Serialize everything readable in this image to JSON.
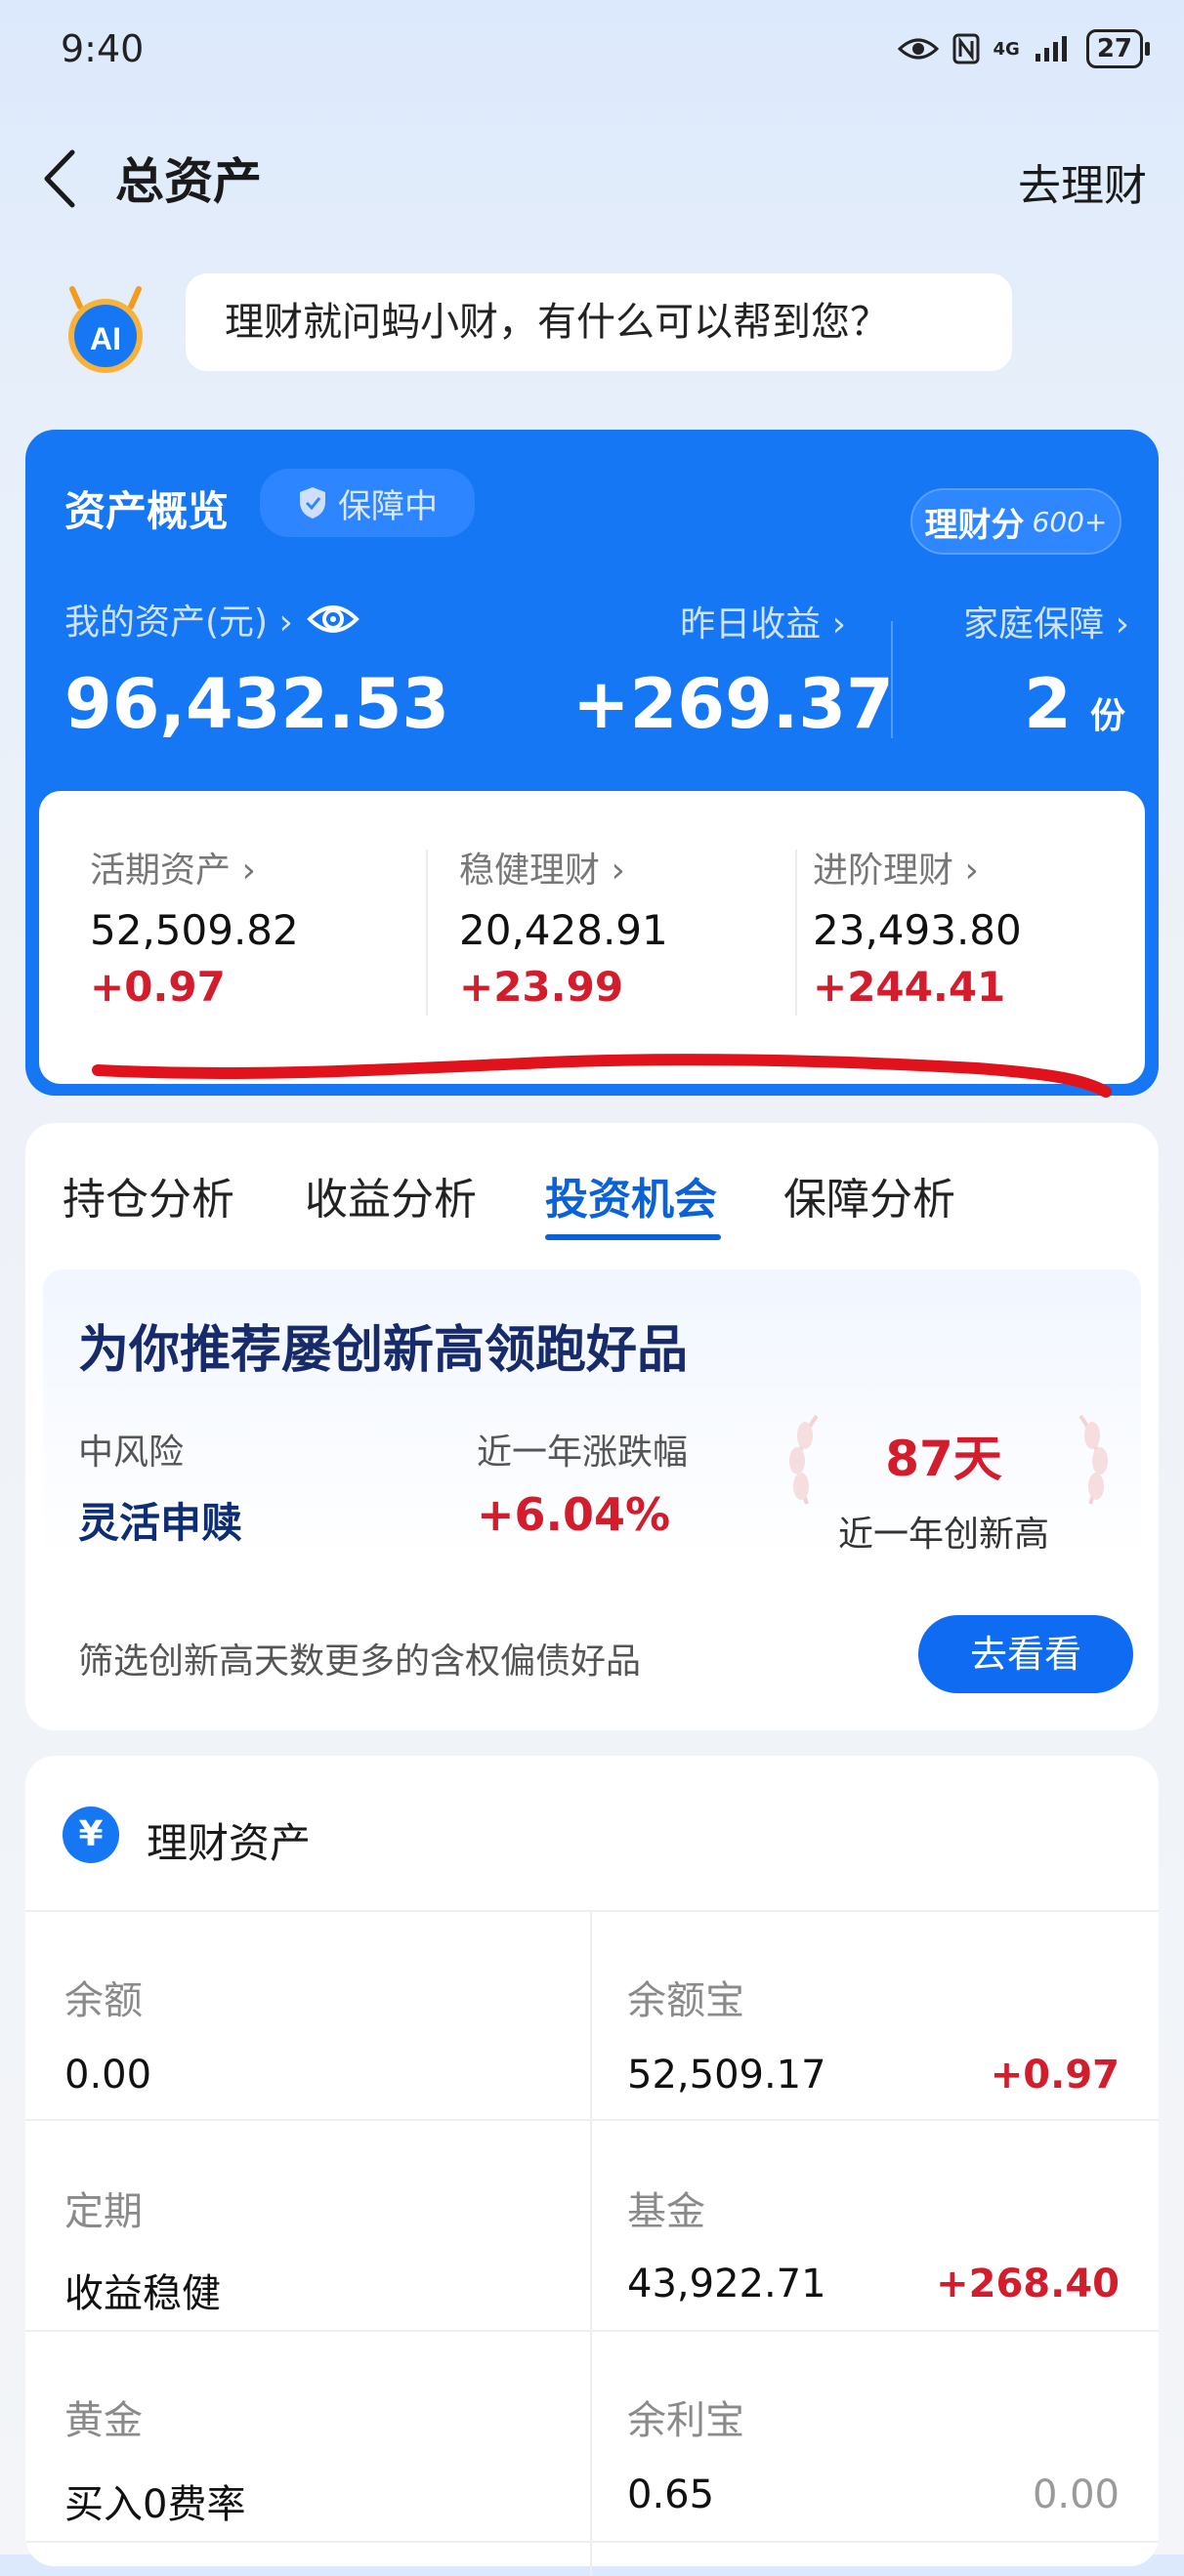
{
  "status": {
    "time": "9:40",
    "network": "4G",
    "battery": "27"
  },
  "header": {
    "title": "总资产",
    "right_link": "去理财"
  },
  "assistant": {
    "message": "理财就问蚂小财，有什么可以帮到您？",
    "avatar_text": "AI"
  },
  "overview": {
    "title": "资产概览",
    "badge": "保障中",
    "score_label": "理财分",
    "score_value": "600+",
    "my_assets_label": "我的资产(元) ›",
    "my_assets_value": "96,432.53",
    "yesterday_label": "昨日收益 ›",
    "yesterday_value": "+269.37",
    "family_label": "家庭保障 ›",
    "family_value": "2",
    "family_unit": "份",
    "breakdown": [
      {
        "label": "活期资产 ›",
        "value": "52,509.82",
        "change": "+0.97"
      },
      {
        "label": "稳健理财 ›",
        "value": "20,428.91",
        "change": "+23.99"
      },
      {
        "label": "进阶理财 ›",
        "value": "23,493.80",
        "change": "+244.41"
      }
    ]
  },
  "tabs": [
    {
      "label": "持仓分析"
    },
    {
      "label": "收益分析"
    },
    {
      "label": "投资机会"
    },
    {
      "label": "保障分析"
    }
  ],
  "active_tab": "投资机会",
  "recommendation": {
    "title": "为你推荐屡创新高领跑好品",
    "risk_label": "中风险",
    "redeem_label": "灵活申赎",
    "change_label": "近一年涨跌幅",
    "change_value": "+6.04%",
    "days_value": "87天",
    "days_label": "近一年创新高",
    "footer_text": "筛选创新高天数更多的含权偏债好品",
    "button_label": "去看看"
  },
  "assets": {
    "icon": "¥",
    "title": "理财资产",
    "rows": [
      {
        "left_label": "余额",
        "left_value": "0.00",
        "right_label": "余额宝",
        "right_value": "52,509.17",
        "right_change": "+0.97"
      },
      {
        "left_label": "定期",
        "left_value": "收益稳健",
        "right_label": "基金",
        "right_value": "43,922.71",
        "right_change": "+268.40"
      },
      {
        "left_label": "黄金",
        "left_value": "买入0费率",
        "right_label": "余利宝",
        "right_value": "0.65",
        "right_change": "0.00"
      }
    ]
  },
  "colors": {
    "primary": "#1677f5",
    "positive": "#d31c2c",
    "annotation": "#e0121c"
  }
}
